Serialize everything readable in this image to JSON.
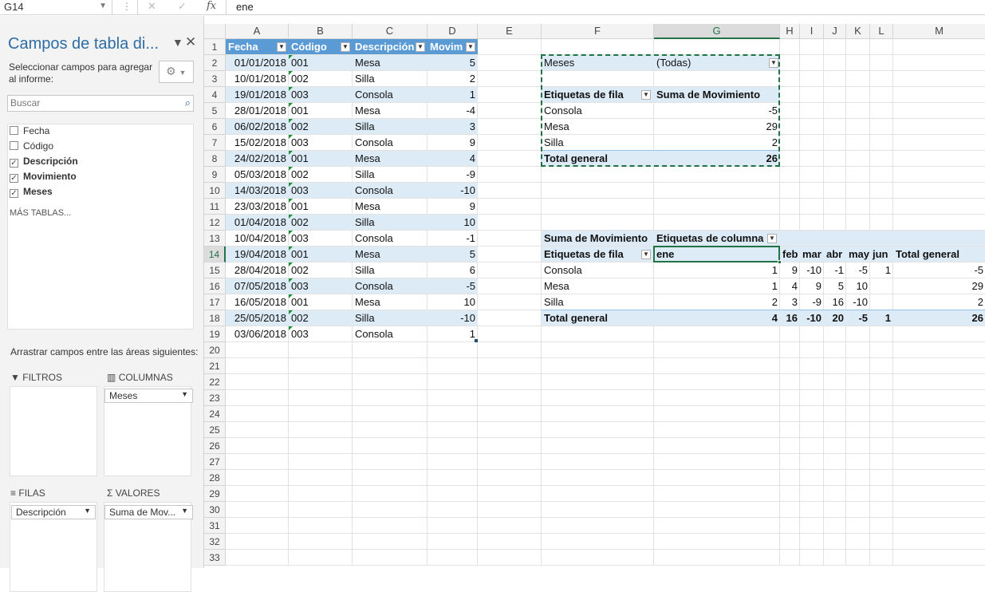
{
  "formula_bar": {
    "name_box": "G14",
    "fx": "fx",
    "value": "ene",
    "cancel": "✕",
    "confirm": "✓"
  },
  "pane": {
    "title": "Campos de tabla di...",
    "description": "Seleccionar campos para agregar al informe:",
    "search_placeholder": "Buscar",
    "fields": [
      {
        "label": "Fecha",
        "checked": false
      },
      {
        "label": "Código",
        "checked": false
      },
      {
        "label": "Descripción",
        "checked": true
      },
      {
        "label": "Movimiento",
        "checked": true
      },
      {
        "label": "Meses",
        "checked": true
      }
    ],
    "more_tables": "MÁS TABLAS...",
    "drag_hint": "Arrastrar campos entre las áreas siguientes:",
    "areas": {
      "filters": {
        "label": "FILTROS"
      },
      "columns": {
        "label": "COLUMNAS",
        "chip": "Meses"
      },
      "rows": {
        "label": "FILAS",
        "chip": "Descripción"
      },
      "values": {
        "label": "VALORES",
        "chip": "Suma de Mov..."
      }
    }
  },
  "sheet": {
    "columns": [
      "A",
      "B",
      "C",
      "D",
      "E",
      "F",
      "G",
      "H",
      "I",
      "J",
      "K",
      "L",
      "M"
    ],
    "selected_cell": "G14",
    "table_headers": [
      "Fecha",
      "Código",
      "Descripción",
      "Movim"
    ],
    "table_rows": [
      [
        "01/01/2018",
        "001",
        "Mesa",
        "5"
      ],
      [
        "10/01/2018",
        "002",
        "Silla",
        "2"
      ],
      [
        "19/01/2018",
        "003",
        "Consola",
        "1"
      ],
      [
        "28/01/2018",
        "001",
        "Mesa",
        "-4"
      ],
      [
        "06/02/2018",
        "002",
        "Silla",
        "3"
      ],
      [
        "15/02/2018",
        "003",
        "Consola",
        "9"
      ],
      [
        "24/02/2018",
        "001",
        "Mesa",
        "4"
      ],
      [
        "05/03/2018",
        "002",
        "Silla",
        "-9"
      ],
      [
        "14/03/2018",
        "003",
        "Consola",
        "-10"
      ],
      [
        "23/03/2018",
        "001",
        "Mesa",
        "9"
      ],
      [
        "01/04/2018",
        "002",
        "Silla",
        "10"
      ],
      [
        "10/04/2018",
        "003",
        "Consola",
        "-1"
      ],
      [
        "19/04/2018",
        "001",
        "Mesa",
        "5"
      ],
      [
        "28/04/2018",
        "002",
        "Silla",
        "6"
      ],
      [
        "07/05/2018",
        "003",
        "Consola",
        "-5"
      ],
      [
        "16/05/2018",
        "001",
        "Mesa",
        "10"
      ],
      [
        "25/05/2018",
        "002",
        "Silla",
        "-10"
      ],
      [
        "03/06/2018",
        "003",
        "Consola",
        "1"
      ]
    ],
    "pivot1": {
      "filter_label": "Meses",
      "filter_value": "(Todas)",
      "row_label": "Etiquetas de fila",
      "value_label": "Suma de Movimiento",
      "rows": [
        [
          "Consola",
          "-5"
        ],
        [
          "Mesa",
          "29"
        ],
        [
          "Silla",
          "2"
        ]
      ],
      "total": [
        "Total general",
        "26"
      ]
    },
    "pivot2": {
      "value_label": "Suma de Movimiento",
      "col_label": "Etiquetas de columna",
      "row_label": "Etiquetas de fila",
      "months": [
        "ene",
        "feb",
        "mar",
        "abr",
        "may",
        "jun",
        "Total general"
      ],
      "rows": [
        [
          "Consola",
          "1",
          "9",
          "-10",
          "-1",
          "-5",
          "1",
          "-5"
        ],
        [
          "Mesa",
          "1",
          "4",
          "9",
          "5",
          "10",
          "",
          "29"
        ],
        [
          "Silla",
          "2",
          "3",
          "-9",
          "16",
          "-10",
          "",
          "2"
        ]
      ],
      "total": [
        "Total general",
        "4",
        "16",
        "-10",
        "20",
        "-5",
        "1",
        "26"
      ]
    }
  }
}
